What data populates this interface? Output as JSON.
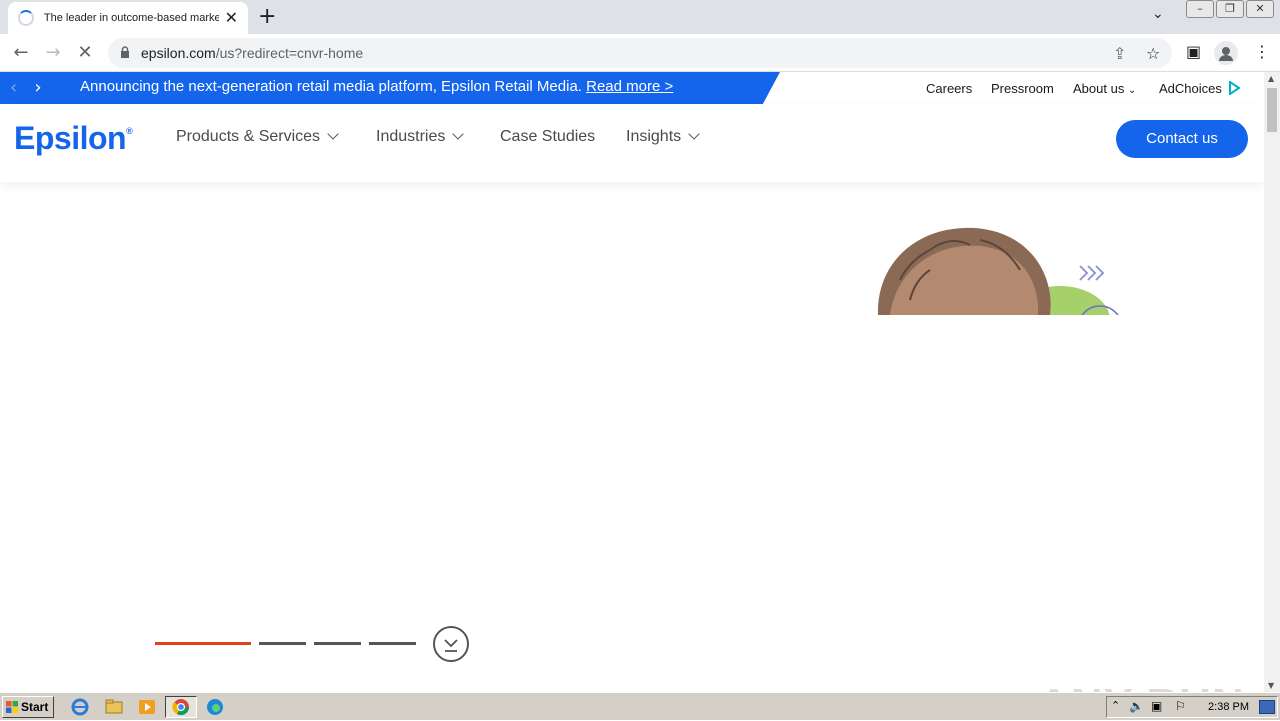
{
  "browser": {
    "tab_title": "The leader in outcome-based marketing",
    "url_host": "epsilon.com",
    "url_path": "/us?redirect=cnvr-home"
  },
  "banner": {
    "message": "Announcing the next-generation retail media platform, Epsilon Retail Media.",
    "link_text": "Read more >"
  },
  "utility_nav": {
    "careers": "Careers",
    "pressroom": "Pressroom",
    "about": "About us",
    "adchoices": "AdChoices"
  },
  "main_nav": {
    "logo": "Epsilon",
    "items": [
      "Products & Services",
      "Industries",
      "Case Studies",
      "Insights"
    ],
    "cta": "Contact us"
  },
  "carousel": {
    "slide_count": 4,
    "active_index": 0
  },
  "watermark": "ANY RUN",
  "taskbar": {
    "start_label": "Start",
    "clock": "2:38 PM"
  },
  "colors": {
    "brand_blue": "#1564ec",
    "carousel_active": "#e0421f",
    "carousel_inactive": "#555555"
  }
}
